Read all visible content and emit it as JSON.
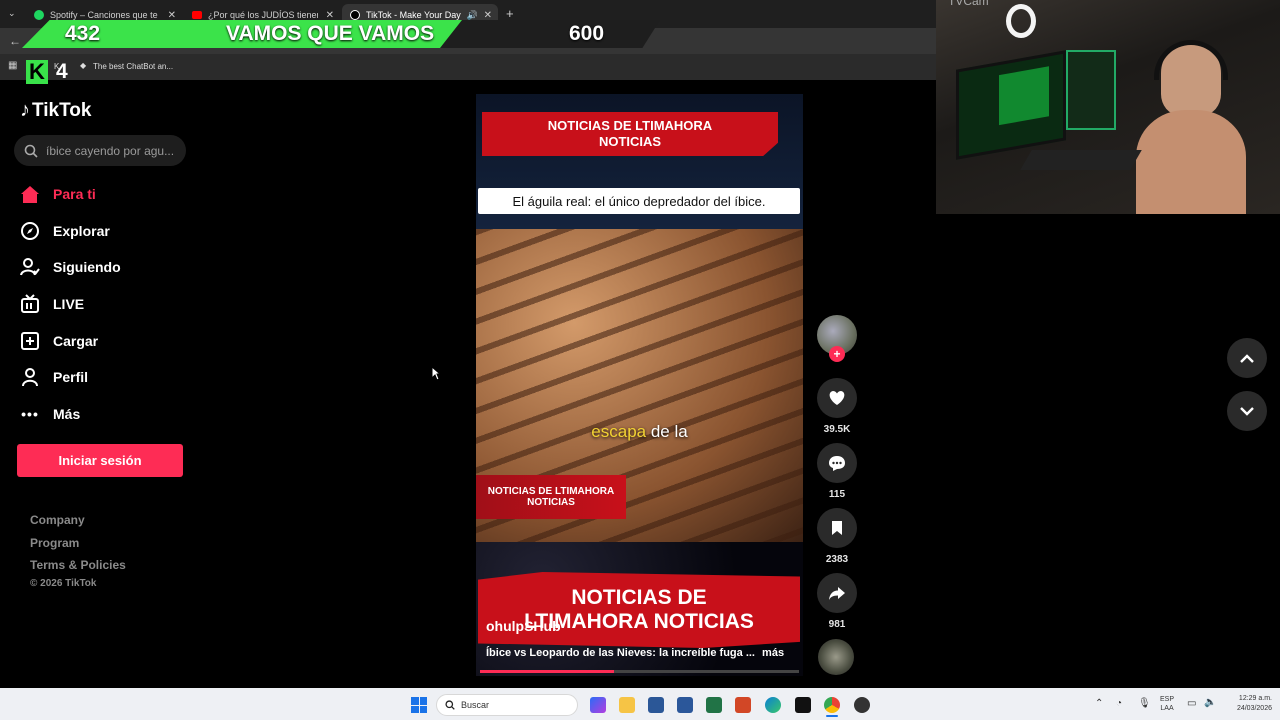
{
  "browser": {
    "tabs": [
      {
        "label": "Spotify – Canciones que te gusta",
        "icon": "spotify-icon",
        "color": "#1ed760"
      },
      {
        "label": "¿Por qué los JUDÍOS tienen tan",
        "icon": "youtube-icon",
        "color": "#ff0000"
      },
      {
        "label": "TikTok - Make Your Day",
        "icon": "tiktok-icon",
        "color": "#ffffff"
      }
    ],
    "bookmark": "The best ChatBot an...",
    "bookmark_short": "K"
  },
  "overlay": {
    "left_number": "432",
    "slogan": "VAMOS QUE VAMOS",
    "right_number": "600",
    "k_count": "4",
    "cam_label": "TVCam"
  },
  "sidebar": {
    "logo": "TikTok",
    "search_placeholder": "íbice cayendo por agu...",
    "items": [
      {
        "label": "Para ti",
        "icon": "home-icon",
        "active": true
      },
      {
        "label": "Explorar",
        "icon": "compass-icon"
      },
      {
        "label": "Siguiendo",
        "icon": "following-icon"
      },
      {
        "label": "LIVE",
        "icon": "live-icon"
      },
      {
        "label": "Cargar",
        "icon": "upload-icon"
      },
      {
        "label": "Perfil",
        "icon": "profile-icon"
      },
      {
        "label": "Más",
        "icon": "more-icon"
      }
    ],
    "login_button": "Iniciar sesión",
    "footer": [
      "Company",
      "Program",
      "Terms & Policies"
    ],
    "copyright": "© 2026 TikTok"
  },
  "video": {
    "top_banner": "NOTICIAS DE LTIMAHORA NOTICIAS",
    "caption_box": "El águila real: el único depredador del íbice.",
    "subtitle_highlight": "escapa",
    "subtitle_rest": " de la",
    "lower_third": "NOTICIAS DE LTIMAHORA NOTICIAS",
    "bottom_banner": "NOTICIAS DE LTIMAHORA NOTICIAS",
    "author": "ohulpSHub",
    "description": "Íbice vs Leopardo de las Nieves: la increíble fuga ...",
    "more": "más",
    "progress": 0.42
  },
  "actions": {
    "likes": "39.5K",
    "comments": "115",
    "saves": "2383",
    "shares": "981"
  },
  "taskbar": {
    "search": "Buscar",
    "lang_top": "ESP",
    "lang_bottom": "LAA",
    "time": "12:29 a.m.",
    "date": "24/03/2026"
  },
  "colors": {
    "accent": "#fe2c55",
    "overlay_green": "#3be34a",
    "subtitle_yellow": "#f2d233"
  }
}
